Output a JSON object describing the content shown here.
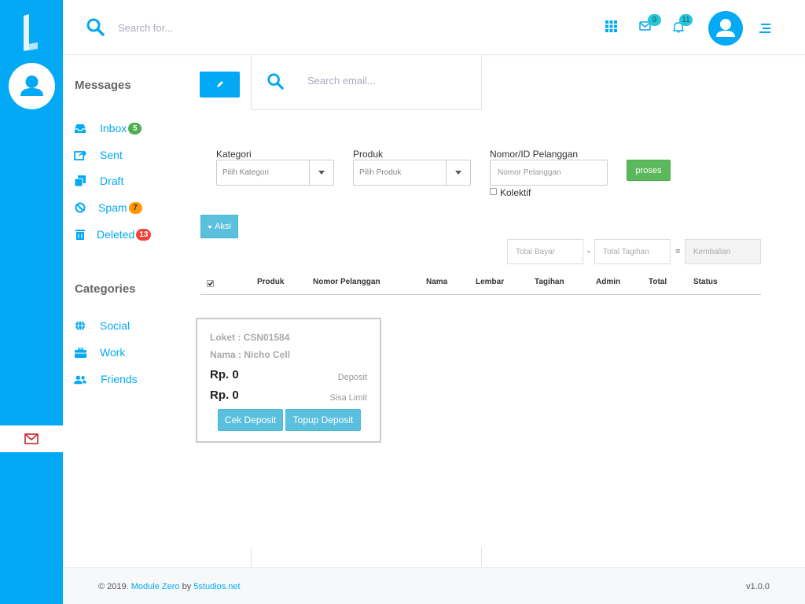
{
  "topbar": {
    "search_placeholder": "Search for...",
    "mail_count": "9",
    "notification_count": "11"
  },
  "sidebar": {
    "messages_title": "Messages",
    "messages": [
      {
        "label": "Inbox",
        "count": "5",
        "count_color": "#4caf50",
        "icon": "inbox-icon"
      },
      {
        "label": "Sent",
        "icon": "share-icon"
      },
      {
        "label": "Draft",
        "icon": "copy-icon"
      },
      {
        "label": "Spam",
        "count": "7",
        "count_color": "#ff9800",
        "icon": "ban-icon"
      },
      {
        "label": "Deleted",
        "count": "13",
        "count_color": "#f44336",
        "icon": "trash-icon"
      }
    ],
    "categories_title": "Categories",
    "categories": [
      {
        "label": "Social",
        "icon": "globe-icon"
      },
      {
        "label": "Work",
        "icon": "briefcase-icon"
      },
      {
        "label": "Friends",
        "icon": "users-icon"
      }
    ]
  },
  "email_search": {
    "placeholder": "Search email..."
  },
  "form": {
    "kategori_label": "Kategori",
    "kategori_value": "Pilih Kategori",
    "produk_label": "Produk",
    "produk_value": "Pilih Produk",
    "nomor_label": "Nomor/ID Pelanggan",
    "nomor_placeholder": "Nomor Pelanggan",
    "kolektif_label": "Kolektif",
    "proses_label": "proses",
    "aksi_label": "Aksi",
    "total_bayar_placeholder": "Total Bayar",
    "minus": "-",
    "total_tagihan_placeholder": "Total Tagihan",
    "equals": "=",
    "kembalian_placeholder": "Kembalian"
  },
  "table": {
    "headers": [
      "Produk",
      "Nomor Pelanggan",
      "Nama",
      "Lembar",
      "Tagihan",
      "Admin",
      "Total",
      "Status"
    ]
  },
  "deposit_card": {
    "loket": "Loket : CSN01584",
    "nama": "Nama : Nicho Cell",
    "deposit_value": "Rp. 0",
    "deposit_label": "Deposit",
    "limit_value": "Rp. 0",
    "limit_label": "Sisa Limit",
    "cek_button": "Cek Deposit",
    "topup_button": "Topup Deposit"
  },
  "footer": {
    "copyright": "© 2019.",
    "product": "Module Zero",
    "by": "by",
    "company": "5studios.net",
    "version": "v1.0.0"
  },
  "colors": {
    "primary": "#03a9f4",
    "success": "#5cb85c",
    "info": "#5bc0de"
  }
}
